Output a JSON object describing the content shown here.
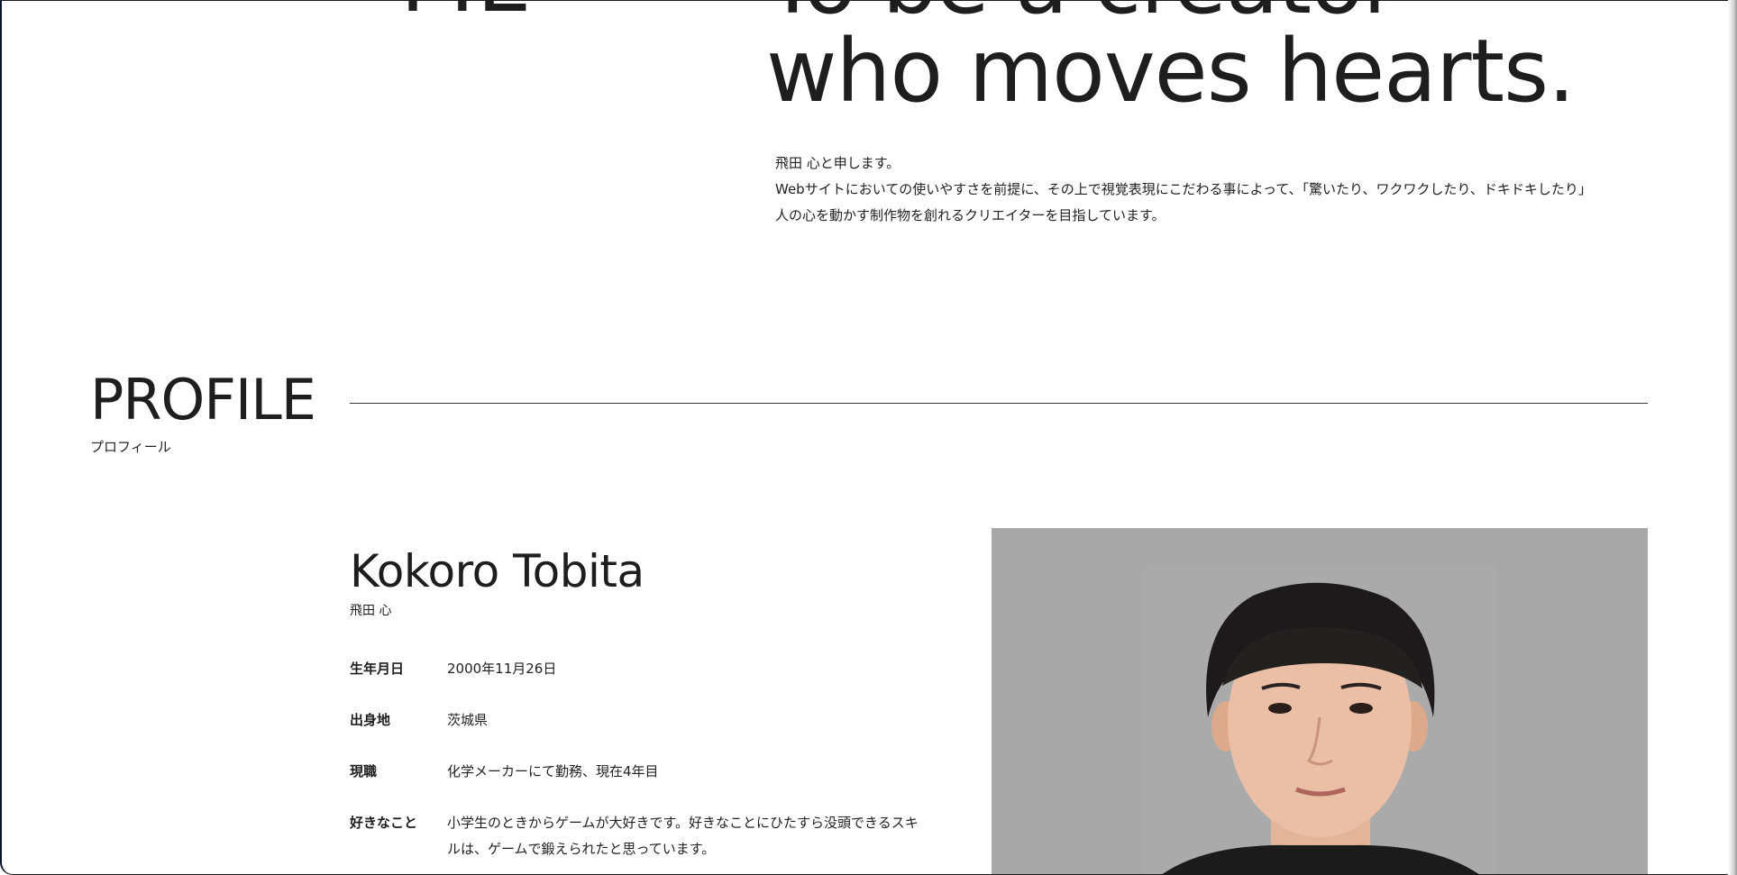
{
  "hero": {
    "left_fragment": "ME",
    "line1": "To be a creator",
    "line2": "who moves hearts."
  },
  "intro": {
    "lines": [
      "飛田 心と申します。",
      "Webサイトにおいての使いやすさを前提に、その上で視覚表現にこだわる事によって、「驚いたり、ワクワクしたり、ドキドキしたり」",
      "人の心を動かす制作物を創れるクリエイターを目指しています。"
    ]
  },
  "profile": {
    "title": "PROFILE",
    "subtitle": "プロフィール",
    "name_en": "Kokoro Tobita",
    "name_ja": "飛田 心",
    "rows": [
      {
        "label": "生年月日",
        "value": "2000年11月26日"
      },
      {
        "label": "出身地",
        "value": "茨城県"
      },
      {
        "label": "現職",
        "value": "化学メーカーにて勤務、現在4年目"
      },
      {
        "label": "好きなこと",
        "value": "小学生のときからゲームが大好きです。好きなことにひたすら没頭できるスキルは、ゲームで鍛えられたと思っています。"
      }
    ]
  },
  "colors": {
    "text": "#1e1e1e",
    "photo_bg": "#a7a7a7",
    "rule": "#333333"
  }
}
